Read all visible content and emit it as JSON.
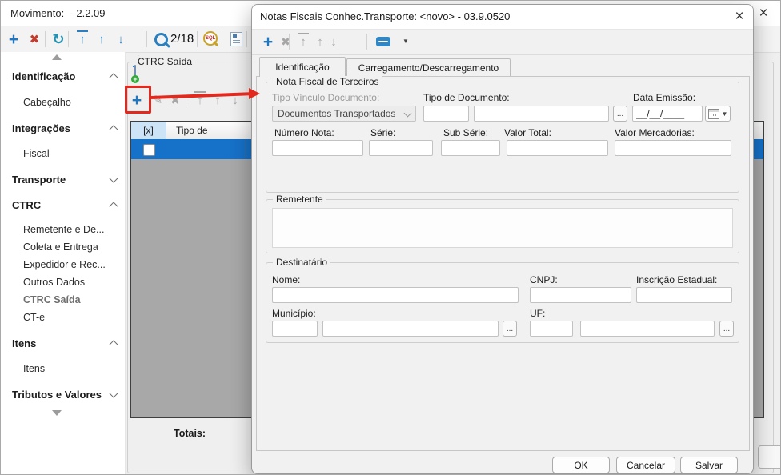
{
  "main_window": {
    "title": "Movimento:  - 2.2.09",
    "toolbar": {
      "record_counter": "2/18",
      "sql_icon_label": "SQL"
    },
    "sidebar": {
      "items": [
        {
          "label": "Identificação",
          "type": "header",
          "chevron": "up"
        },
        {
          "label": "Cabeçalho",
          "type": "item"
        },
        {
          "label": "Integrações",
          "type": "header",
          "chevron": "up"
        },
        {
          "label": "Fiscal",
          "type": "item"
        },
        {
          "label": "Transporte",
          "type": "header",
          "chevron": "down"
        },
        {
          "label": "CTRC",
          "type": "header",
          "chevron": "up"
        },
        {
          "label": "Remetente e De...",
          "type": "item"
        },
        {
          "label": "Coleta e Entrega",
          "type": "item"
        },
        {
          "label": "Expedidor e Rec...",
          "type": "item"
        },
        {
          "label": "Outros Dados",
          "type": "item"
        },
        {
          "label": "CTRC Saída",
          "type": "item",
          "selected": true
        },
        {
          "label": "CT-e",
          "type": "item"
        },
        {
          "label": "Itens",
          "type": "header",
          "chevron": "up"
        },
        {
          "label": "Itens",
          "type": "item"
        },
        {
          "label": "Tributos e Valores",
          "type": "header",
          "chevron": "down"
        }
      ]
    },
    "panel": {
      "title": "CTRC Saída",
      "table": {
        "columns": [
          "[x]",
          "Tipo de"
        ]
      },
      "totals_label": "Totais:"
    }
  },
  "dialog": {
    "title": "Notas Fiscais Conhec.Transporte: <novo> - 03.9.0520",
    "tabs": [
      {
        "label": "Identificação",
        "active": true
      },
      {
        "label": "Carregamento/Descarregamento",
        "active": false
      }
    ],
    "nota_fiscal_group": {
      "title": "Nota Fiscal de Terceiros",
      "tipo_vinculo_label": "Tipo Vínculo Documento:",
      "tipo_vinculo_value": "Documentos Transportados",
      "tipo_documento_label": "Tipo de Documento:",
      "data_emissao_label": "Data Emissão:",
      "data_emissao_mask": "__/__/____",
      "numero_nota_label": "Número Nota:",
      "serie_label": "Série:",
      "sub_serie_label": "Sub Série:",
      "valor_total_label": "Valor Total:",
      "valor_mercadorias_label": "Valor Mercadorias:"
    },
    "remetente_group": {
      "title": "Remetente"
    },
    "destinatario_group": {
      "title": "Destinatário",
      "nome_label": "Nome:",
      "cnpj_label": "CNPJ:",
      "inscricao_estadual_label": "Inscrição Estadual:",
      "municipio_label": "Município:",
      "uf_label": "UF:"
    },
    "browse_label": "...",
    "buttons": {
      "ok": "OK",
      "cancel": "Cancelar",
      "save": "Salvar"
    }
  },
  "icons": {
    "add": "+",
    "delete": "✖",
    "edit": "✎",
    "refresh": "↻",
    "arrow_up": "↑",
    "arrow_down": "↓",
    "caret_down": "▼",
    "close": "×"
  },
  "colors": {
    "selection_blue": "#1671c8",
    "toolbar_blue": "#2176bd",
    "toolbar_red": "#c23b2e",
    "annotation_red": "#e3281e"
  }
}
